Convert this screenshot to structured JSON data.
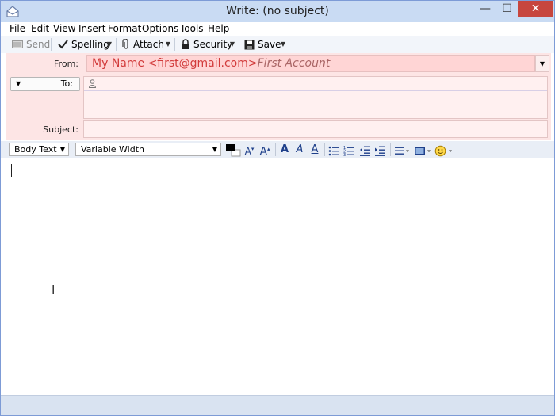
{
  "window": {
    "title": "Write: (no subject)"
  },
  "titlebar_buttons": {
    "minimize": "—",
    "maximize": "☐",
    "close": "✕"
  },
  "menu": [
    "File",
    "Edit",
    "View",
    "Insert",
    "Format",
    "Options",
    "Tools",
    "Help"
  ],
  "toolbar": {
    "send": "Send",
    "spelling": "Spelling",
    "attach": "Attach",
    "security": "Security",
    "save": "Save"
  },
  "header": {
    "from_label": "From:",
    "from_name": "My Name <first@gmail.com>",
    "from_account": "First Account",
    "to_label": "To:",
    "subject_label": "Subject:",
    "subject_value": ""
  },
  "formatbar": {
    "paragraph_style": "Body Text",
    "font": "Variable Width",
    "text_color": "#000000"
  }
}
